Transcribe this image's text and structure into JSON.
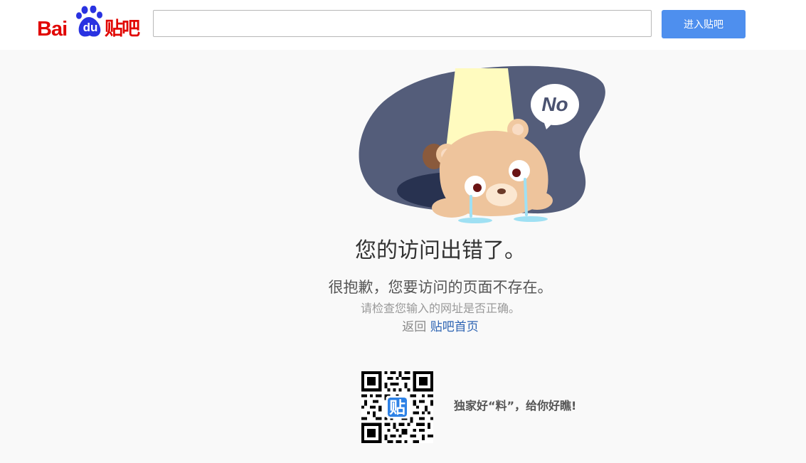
{
  "header": {
    "logo": {
      "text_bai": "Bai",
      "text_du": "du",
      "text_tieba": "贴吧"
    },
    "search": {
      "value": "",
      "placeholder": ""
    },
    "enter_button_label": "进入贴吧"
  },
  "illustration": {
    "speech_bubble_text": "No",
    "icon": "crying-bear-icon"
  },
  "error": {
    "title": "您的访问出错了。",
    "subtitle": "很抱歉，您要访问的页面不存在。",
    "hint": "请检查您输入的网址是否正确。",
    "return_prefix": "返回",
    "return_link_label": "贴吧首页"
  },
  "promo": {
    "qr_badge": "贴",
    "slogan": "独家好“料”，给你好瞧!"
  },
  "colors": {
    "brand_red": "#e10602",
    "brand_blue": "#2932e1",
    "button_blue": "#4e8fee",
    "link_blue": "#2d64b3",
    "page_bg": "#f9f9f9"
  }
}
